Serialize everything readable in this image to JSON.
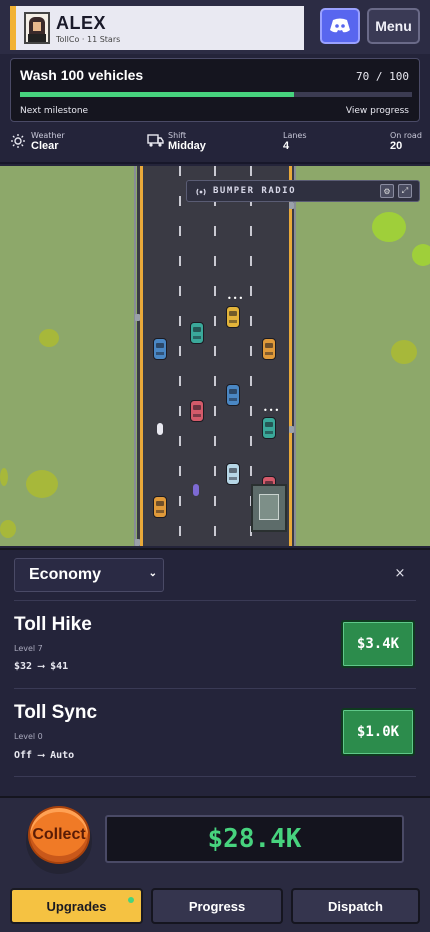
{
  "player": {
    "name": "ALEX",
    "subtitle": "TollCo · 11 Stars"
  },
  "header": {
    "menu_label": "Menu",
    "discord_icon": "discord-icon"
  },
  "goal": {
    "title": "Wash 100 vehicles",
    "count_text": "70 / 100",
    "progress": 0.7,
    "left_label": "Next milestone",
    "right_label": "View progress"
  },
  "stats": [
    {
      "label": "Weather",
      "value": "Clear",
      "icon": "sun-icon"
    },
    {
      "label": "Shift",
      "value": "Midday",
      "icon": "truck-icon"
    },
    {
      "label": "Lanes",
      "value": "4"
    },
    {
      "label": "On road",
      "value": "20"
    }
  ],
  "radio": {
    "title": "BUMPER RADIO"
  },
  "panel": {
    "category": "Economy",
    "close_label": "×",
    "upgrades": [
      {
        "name": "Toll Hike",
        "level": "Level 7",
        "change": "$32 ⟶ $41",
        "price": "$3.4K"
      },
      {
        "name": "Toll Sync",
        "level": "Level 0",
        "change": "Off ⟶ Auto",
        "price": "$1.0K"
      }
    ]
  },
  "collect_label": "Collect",
  "money": "$28.4K",
  "tabs": [
    {
      "label": "Upgrades"
    },
    {
      "label": "Progress"
    },
    {
      "label": "Dispatch"
    }
  ],
  "colors": {
    "accent_green": "#47d37e",
    "collect_orange": "#f07a26",
    "tab_active": "#f5c242",
    "discord": "#5866ef"
  }
}
